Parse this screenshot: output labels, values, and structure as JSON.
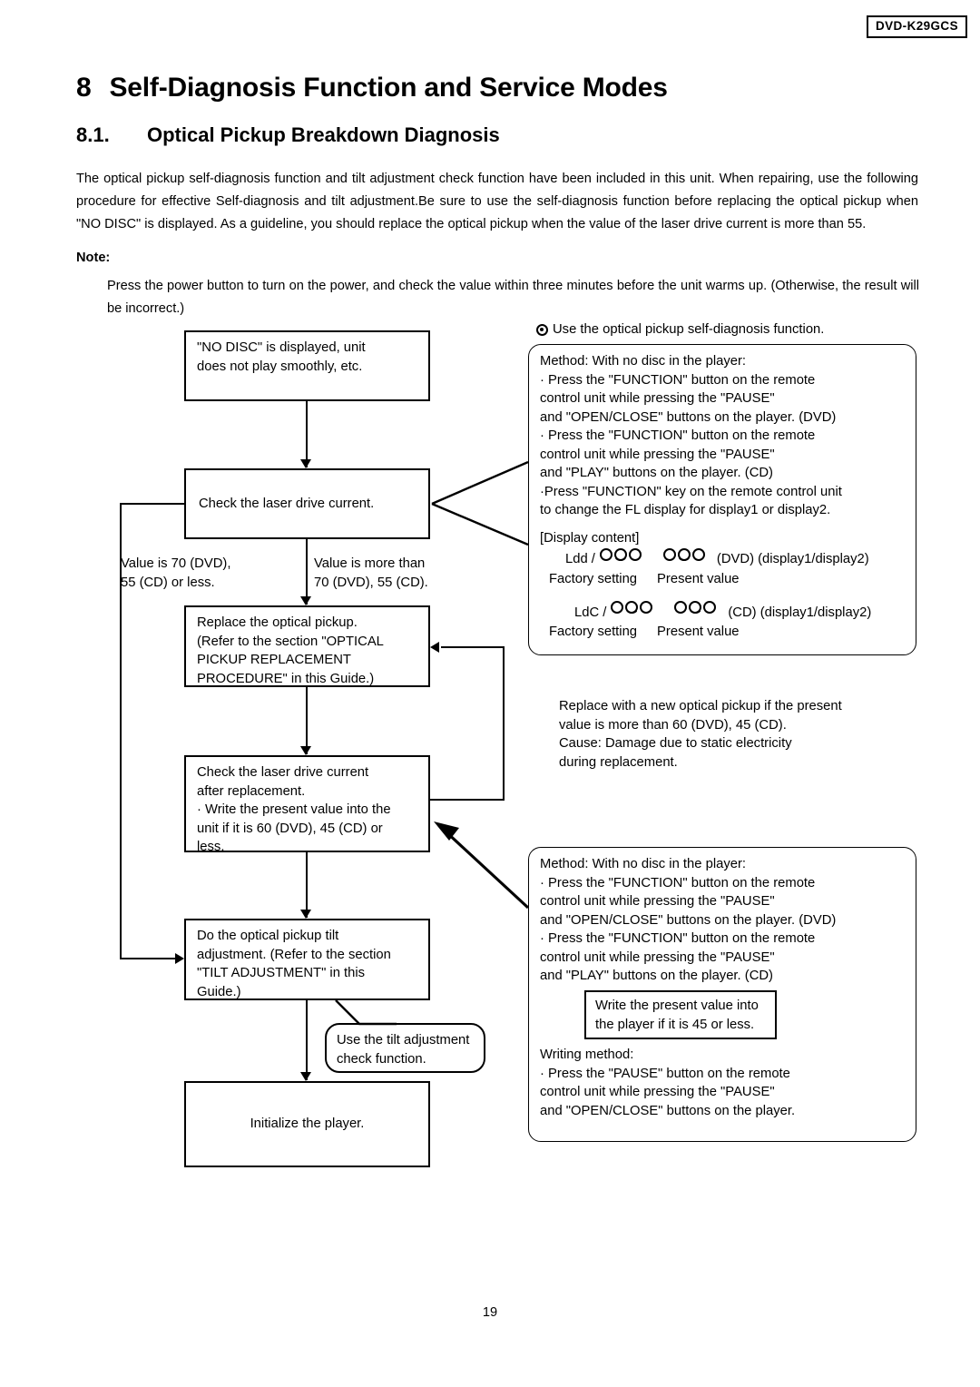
{
  "header": {
    "model_number": "DVD-K29GCS"
  },
  "titles": {
    "chapter_number": "8",
    "chapter_title": "Self-Diagnosis Function and Service Modes",
    "section_number": "8.1.",
    "section_title": "Optical Pickup Breakdown Diagnosis"
  },
  "body": {
    "intro": "The optical pickup self-diagnosis function and tilt adjustment check function have been included in this unit. When repairing, use the following procedure for effective Self-diagnosis and tilt adjustment.Be sure to use the self-diagnosis function before replacing the optical pickup when \"NO DISC\" is displayed. As a guideline, you should replace the optical pickup when the value of the laser drive current is more than 55.",
    "note_label": "Note:",
    "note_text": "Press the power button to turn on the power, and check the value within three minutes before the unit warms up. (Otherwise, the result will be incorrect.)"
  },
  "flowchart": {
    "box_no_disc": "\"NO DISC\" is displayed, unit\ndoes not play smoothly, etc.",
    "box_check_current": "Check the laser drive current.",
    "label_branch_left": "Value is 70 (DVD),\n55 (CD) or less.",
    "label_branch_right": "Value is more than\n70 (DVD), 55 (CD).",
    "box_replace_pickup": "Replace the optical pickup.\n(Refer to the section \"OPTICAL\nPICKUP REPLACEMENT\nPROCEDURE\" in this Guide.)",
    "box_check_after": "Check the laser drive current\nafter replacement.\n· Write the present value into the\n   unit if it is 60 (DVD), 45 (CD) or\n   less.",
    "box_tilt_adjust": "Do the optical pickup tilt\nadjustment.  (Refer to the section\n\"TILT ADJUSTMENT\" in this\nGuide.)",
    "bubble_tilt_check": "Use the tilt adjustment\ncheck function.",
    "box_initialize": "Initialize the player."
  },
  "right_panel": {
    "heading": "Use the optical pickup self-diagnosis function.",
    "heading_icon": "bullseye-icon",
    "method_box": {
      "line_method": "Method: With no disc in the player:",
      "bullet_1": "· Press the \"FUNCTION\" button on the remote\n   control unit while pressing the \"PAUSE\"\n   and \"OPEN/CLOSE\" buttons on the player. (DVD)",
      "bullet_2": "· Press the \"FUNCTION\" button on the remote\n   control unit while pressing the \"PAUSE\"\n   and \"PLAY\" buttons on the player. (CD)",
      "bullet_3": "·Press \"FUNCTION\" key on the remote control unit\n   to change the FL display for display1 or display2.",
      "display_heading": "[Display content]",
      "row_dvd": {
        "prefix": "Ldd /",
        "suffix": "(DVD) (display1/display2)",
        "label_left": "Factory setting",
        "label_right": "Present value",
        "circles_per_group": 3
      },
      "row_cd": {
        "prefix": "LdC /",
        "suffix": "(CD) (display1/display2)",
        "label_left": "Factory setting",
        "label_right": "Present value",
        "circles_per_group": 3
      }
    },
    "replace_note": "Replace with a new optical pickup if the present\nvalue is more than 60 (DVD), 45 (CD).\nCause: Damage due to static electricity\n            during replacement.",
    "tilt_method_box": {
      "line_method": "Method: With no disc in the player:",
      "bullet_1": "· Press the \"FUNCTION\" button on the remote\n   control unit while pressing the \"PAUSE\"\n   and \"OPEN/CLOSE\" buttons on the player. (DVD)",
      "bullet_2": "· Press the \"FUNCTION\" button on the remote\n   control unit while pressing the \"PAUSE\"\n   and \"PLAY\" buttons on the player. (CD)",
      "inner_box": "Write the present value into\nthe player if it is 45 or less.",
      "writing_heading": "Writing method:",
      "writing_bullet": "· Press the \"PAUSE\" button on the remote\n   control unit while pressing the \"PAUSE\"\n   and \"OPEN/CLOSE\" buttons on the player."
    }
  },
  "footer": {
    "page_number": "19"
  }
}
